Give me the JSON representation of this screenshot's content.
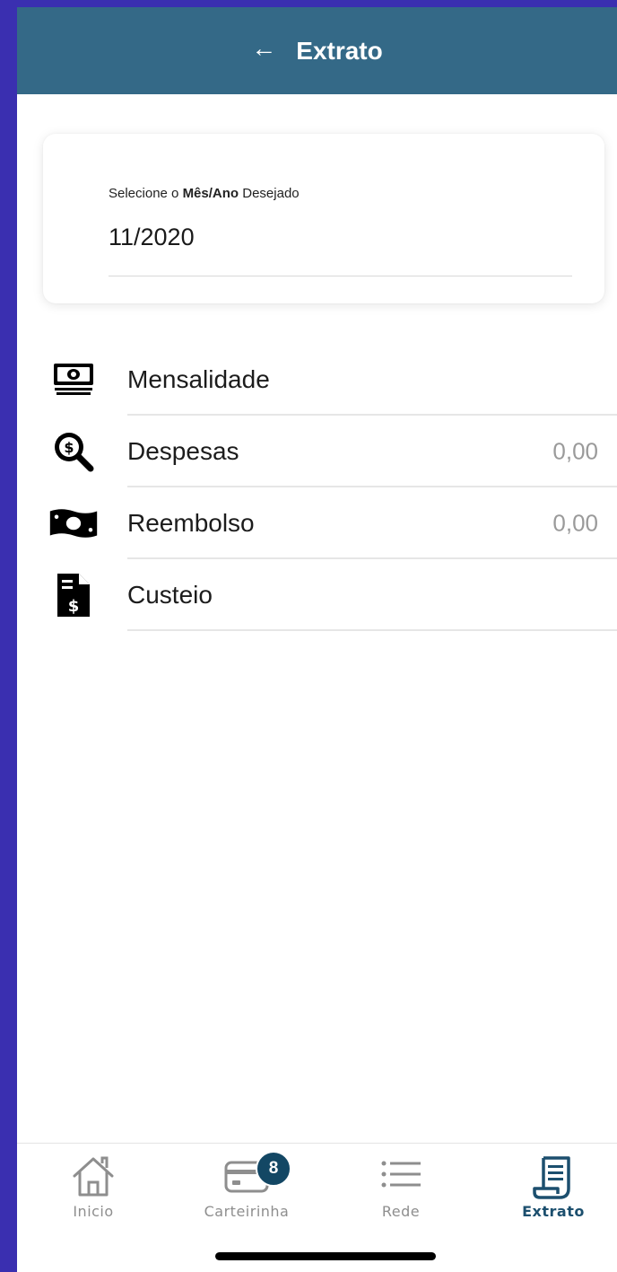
{
  "header": {
    "title": "Extrato"
  },
  "period": {
    "label_prefix": "Selecione o ",
    "label_bold": "Mês/Ano",
    "label_suffix": " Desejado",
    "value": "11/2020"
  },
  "items": [
    {
      "label": "Mensalidade",
      "amount": "",
      "icon": "money-stack-icon"
    },
    {
      "label": "Despesas",
      "amount": "0,00",
      "icon": "dollar-search-icon"
    },
    {
      "label": "Reembolso",
      "amount": "0,00",
      "icon": "banknote-icon"
    },
    {
      "label": "Custeio",
      "amount": "",
      "icon": "invoice-document-icon"
    }
  ],
  "tabbar": {
    "tabs": [
      {
        "label": "Inicio",
        "icon": "home-icon",
        "active": false
      },
      {
        "label": "Carteirinha",
        "icon": "card-icon",
        "active": false,
        "badge": "8"
      },
      {
        "label": "Rede",
        "icon": "list-icon",
        "active": false
      },
      {
        "label": "Extrato",
        "icon": "receipt-icon",
        "active": true
      }
    ]
  },
  "colors": {
    "background": "#3a2fb0",
    "header": "#346987",
    "active_tab": "#1c4f6e",
    "badge": "#134764"
  }
}
